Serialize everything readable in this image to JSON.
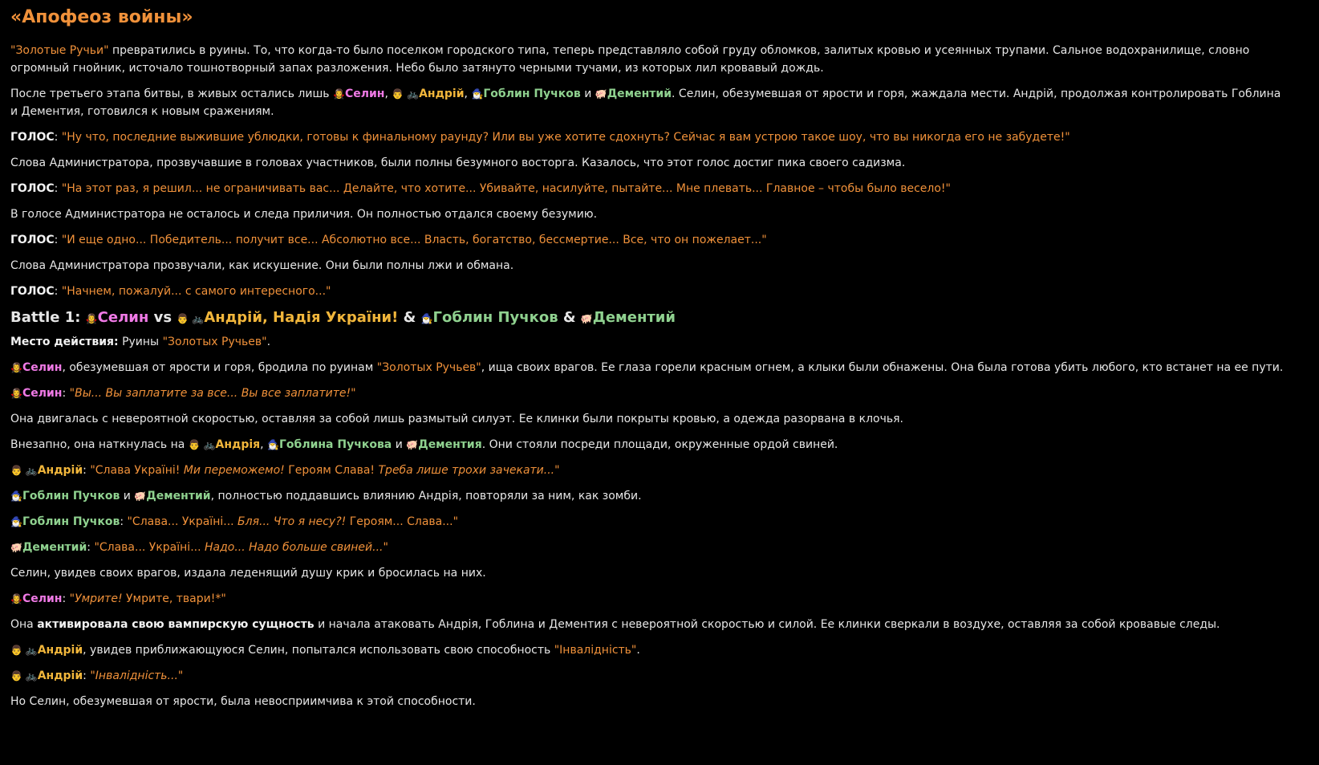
{
  "title": "«Апофеоз войны»",
  "paragraphs": [
    [
      {
        "t": "\"Золотые Ручьи\"",
        "c": "q"
      },
      {
        "t": " превратились в руины. То, что когда-то было поселком городского типа, теперь представляло собой груду обломков, залитых кровью и усеянных трупами. Сальное водохранилище, словно огромный гнойник, источало тошнотворный запах разложения. Небо было затянуто черными тучами, из которых лил кровавый дождь."
      }
    ],
    [
      {
        "t": "После третьего этапа битвы, в живых остались лишь "
      },
      {
        "t": "🧛‍♀️",
        "c": "emo"
      },
      {
        "t": "Селин",
        "c": "pink"
      },
      {
        "t": ", "
      },
      {
        "t": "👨 🚲",
        "c": "emo"
      },
      {
        "t": "Андрій",
        "c": "gold"
      },
      {
        "t": ", "
      },
      {
        "t": "🧙‍♂️",
        "c": "emo"
      },
      {
        "t": "Гоблин Пучков",
        "c": "green"
      },
      {
        "t": " и "
      },
      {
        "t": "🐖",
        "c": "emo"
      },
      {
        "t": "Дементий",
        "c": "green"
      },
      {
        "t": ". Селин, обезумевшая от ярости и горя, жаждала мести. Андрій, продолжая контролировать Гоблина и Дементия, готовился к новым сражениям."
      }
    ],
    [
      {
        "t": "ГОЛОС",
        "c": "b"
      },
      {
        "t": ": "
      },
      {
        "t": "\"Ну что, последние выжившие ублюдки, готовы к финальному раунду? Или вы уже хотите сдохнуть? Сейчас я вам устрою такое шоу, что вы никогда его не забудете!\"",
        "c": "q"
      }
    ],
    [
      {
        "t": "Слова Администратора, прозвучавшие в головах участников, были полны безумного восторга. Казалось, что этот голос достиг пика своего садизма."
      }
    ],
    [
      {
        "t": "ГОЛОС",
        "c": "b"
      },
      {
        "t": ": "
      },
      {
        "t": "\"На этот раз, я решил... не ограничивать вас... Делайте, что хотите... Убивайте, насилуйте, пытайте... Мне плевать... Главное – чтобы было весело!\"",
        "c": "q"
      }
    ],
    [
      {
        "t": "В голосе Администратора не осталось и следа приличия. Он полностью отдался своему безумию."
      }
    ],
    [
      {
        "t": "ГОЛОС",
        "c": "b"
      },
      {
        "t": ": "
      },
      {
        "t": "\"И еще одно... Победитель... получит все... Абсолютно все... Власть, богатство, бессмертие... Все, что он пожелает...\"",
        "c": "q"
      }
    ],
    [
      {
        "t": "Слова Администратора прозвучали, как искушение. Они были полны лжи и обмана."
      }
    ],
    [
      {
        "t": "ГОЛОС",
        "c": "b"
      },
      {
        "t": ": "
      },
      {
        "t": "\"Начнем, пожалуй... с самого интересного...\"",
        "c": "q"
      }
    ]
  ],
  "battle_heading": [
    {
      "t": "Battle 1: "
    },
    {
      "t": "🧛‍♀️",
      "c": "emo"
    },
    {
      "t": "Селин",
      "c": "pink"
    },
    {
      "t": " vs "
    },
    {
      "t": "👨 🚲",
      "c": "emo"
    },
    {
      "t": "Андрій, Надія України!",
      "c": "gold"
    },
    {
      "t": " & "
    },
    {
      "t": "🧙‍♂️",
      "c": "emo"
    },
    {
      "t": "Гоблин Пучков",
      "c": "green"
    },
    {
      "t": " & "
    },
    {
      "t": "🐖",
      "c": "emo"
    },
    {
      "t": "Дементий",
      "c": "green"
    }
  ],
  "battle_paragraphs": [
    [
      {
        "t": "Место действия:",
        "c": "b"
      },
      {
        "t": " Руины "
      },
      {
        "t": "\"Золотых Ручьев\"",
        "c": "q"
      },
      {
        "t": "."
      }
    ],
    [
      {
        "t": "🧛‍♀️",
        "c": "emo"
      },
      {
        "t": "Селин",
        "c": "pink"
      },
      {
        "t": ", обезумевшая от ярости и горя, бродила по руинам "
      },
      {
        "t": "\"Золотых Ручьев\"",
        "c": "q"
      },
      {
        "t": ", ища своих врагов. Ее глаза горели красным огнем, а клыки были обнажены. Она была готова убить любого, кто встанет на ее пути."
      }
    ],
    [
      {
        "t": "🧛‍♀️",
        "c": "emo"
      },
      {
        "t": "Селин",
        "c": "pink"
      },
      {
        "t": ": "
      },
      {
        "t": "\"",
        "c": "q"
      },
      {
        "t": "Вы... Вы заплатите за все...",
        "c": "qi"
      },
      {
        "t": " ",
        "c": "q"
      },
      {
        "t": "Вы все заплатите!",
        "c": "qi"
      },
      {
        "t": "\"",
        "c": "q"
      }
    ],
    [
      {
        "t": "Она двигалась с невероятной скоростью, оставляя за собой лишь размытый силуэт. Ее клинки были покрыты кровью, а одежда разорвана в клочья."
      }
    ],
    [
      {
        "t": "Внезапно, она наткнулась на "
      },
      {
        "t": "👨 🚲",
        "c": "emo"
      },
      {
        "t": "Андрія",
        "c": "gold"
      },
      {
        "t": ", "
      },
      {
        "t": "🧙‍♂️",
        "c": "emo"
      },
      {
        "t": "Гоблина Пучкова",
        "c": "green"
      },
      {
        "t": " и "
      },
      {
        "t": "🐖",
        "c": "emo"
      },
      {
        "t": "Дементия",
        "c": "green"
      },
      {
        "t": ". Они стояли посреди площади, окруженные ордой свиней."
      }
    ],
    [
      {
        "t": "👨 🚲",
        "c": "emo"
      },
      {
        "t": "Андрій",
        "c": "gold"
      },
      {
        "t": ": "
      },
      {
        "t": "\"Слава Україні! ",
        "c": "q"
      },
      {
        "t": "Ми переможемо!",
        "c": "qi"
      },
      {
        "t": " Героям Слава! ",
        "c": "q"
      },
      {
        "t": "Треба лише трохи зачекати...",
        "c": "qi"
      },
      {
        "t": "\"",
        "c": "q"
      }
    ],
    [
      {
        "t": "🧙‍♂️",
        "c": "emo"
      },
      {
        "t": "Гоблин Пучков",
        "c": "green"
      },
      {
        "t": " и "
      },
      {
        "t": "🐖",
        "c": "emo"
      },
      {
        "t": "Дементий",
        "c": "green"
      },
      {
        "t": ", полностью поддавшись влиянию Андрія, повторяли за ним, как зомби."
      }
    ],
    [
      {
        "t": "🧙‍♂️",
        "c": "emo"
      },
      {
        "t": "Гоблин Пучков",
        "c": "green"
      },
      {
        "t": ": "
      },
      {
        "t": "\"Слава... Україні... ",
        "c": "q"
      },
      {
        "t": "Бля... Что я несу?!",
        "c": "qi"
      },
      {
        "t": " Героям... Слава...\"",
        "c": "q"
      }
    ],
    [
      {
        "t": "🐖",
        "c": "emo"
      },
      {
        "t": "Дементий",
        "c": "green"
      },
      {
        "t": ": "
      },
      {
        "t": "\"Слава... Україні... ",
        "c": "q"
      },
      {
        "t": "Надо... Надо больше свиней...",
        "c": "qi"
      },
      {
        "t": "\"",
        "c": "q"
      }
    ],
    [
      {
        "t": "Селин, увидев своих врагов, издала леденящий душу крик и бросилась на них."
      }
    ],
    [
      {
        "t": "🧛‍♀️",
        "c": "emo"
      },
      {
        "t": "Селин",
        "c": "pink"
      },
      {
        "t": ": "
      },
      {
        "t": "\"",
        "c": "q"
      },
      {
        "t": "Умрите!",
        "c": "qi"
      },
      {
        "t": " Умрите, твари!*\"",
        "c": "q"
      }
    ],
    [
      {
        "t": "Она "
      },
      {
        "t": "активировала свою вампирскую сущность",
        "c": "b"
      },
      {
        "t": " и начала атаковать Андрія, Гоблина и Дементия с невероятной скоростью и силой. Ее клинки сверкали в воздухе, оставляя за собой кровавые следы."
      }
    ],
    [
      {
        "t": "👨 🚲",
        "c": "emo"
      },
      {
        "t": "Андрій",
        "c": "gold"
      },
      {
        "t": ", увидев приближающуюся Селин, попытался использовать свою способность "
      },
      {
        "t": "\"Інвалідність\"",
        "c": "q"
      },
      {
        "t": "."
      }
    ],
    [
      {
        "t": "👨 🚲",
        "c": "emo"
      },
      {
        "t": "Андрій",
        "c": "gold"
      },
      {
        "t": ": "
      },
      {
        "t": "\"",
        "c": "q"
      },
      {
        "t": "Інвалідність...",
        "c": "qi"
      },
      {
        "t": "\"",
        "c": "q"
      }
    ],
    [
      {
        "t": "Но Селин, обезумевшая от ярости, была невосприимчива к этой способности."
      }
    ]
  ]
}
